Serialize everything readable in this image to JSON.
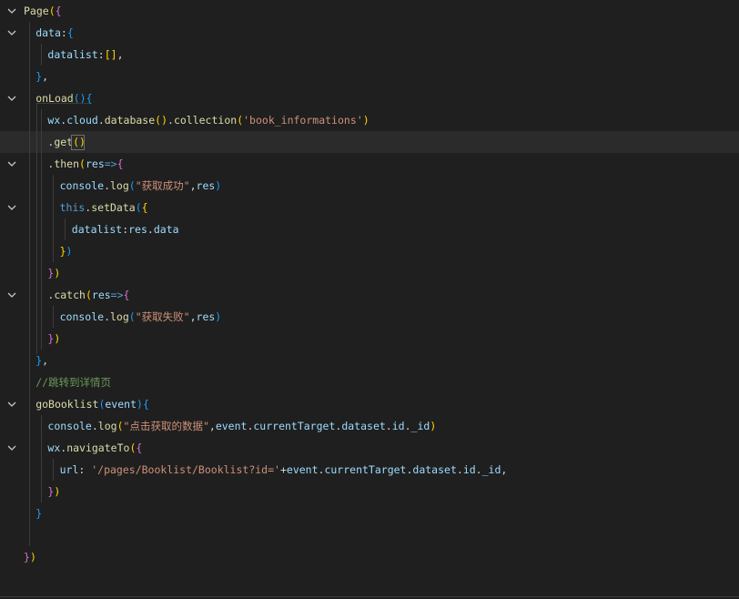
{
  "editor": {
    "lines": [
      {
        "fold": true,
        "tokens": [
          {
            "t": "Page",
            "c": "t-fn"
          },
          {
            "t": "(",
            "c": "t-b1"
          },
          {
            "t": "{",
            "c": "t-b2"
          }
        ]
      },
      {
        "fold": true,
        "tokens": [
          {
            "t": "data",
            "c": "t-ident"
          },
          {
            "t": ":",
            "c": "t-plain"
          },
          {
            "t": "{",
            "c": "t-b3"
          }
        ]
      },
      {
        "fold": false,
        "tokens": [
          {
            "t": "datalist",
            "c": "t-ident"
          },
          {
            "t": ":",
            "c": "t-plain"
          },
          {
            "t": "[]",
            "c": "t-b1"
          },
          {
            "t": ",",
            "c": "t-plain"
          }
        ]
      },
      {
        "fold": false,
        "tokens": [
          {
            "t": "}",
            "c": "t-b3"
          },
          {
            "t": ",",
            "c": "t-plain"
          }
        ]
      },
      {
        "fold": true,
        "tokens": [
          {
            "t": "onLoad",
            "c": "t-fn"
          },
          {
            "t": "()",
            "c": "t-b3"
          },
          {
            "t": "{",
            "c": "t-b3"
          }
        ]
      },
      {
        "fold": false,
        "tokens": [
          {
            "t": "wx",
            "c": "t-ident"
          },
          {
            "t": ".",
            "c": "t-plain"
          },
          {
            "t": "cloud",
            "c": "t-ident"
          },
          {
            "t": ".",
            "c": "t-plain"
          },
          {
            "t": "database",
            "c": "t-fn"
          },
          {
            "t": "()",
            "c": "t-b1"
          },
          {
            "t": ".",
            "c": "t-plain"
          },
          {
            "t": "collection",
            "c": "t-fn"
          },
          {
            "t": "(",
            "c": "t-b1"
          },
          {
            "t": "'book_informations'",
            "c": "t-str"
          },
          {
            "t": ")",
            "c": "t-b1"
          }
        ]
      },
      {
        "fold": false,
        "tokens": [
          {
            "t": ".",
            "c": "t-plain"
          },
          {
            "t": "get",
            "c": "t-fn"
          },
          {
            "t": "()",
            "c": "t-b1"
          }
        ]
      },
      {
        "fold": true,
        "tokens": [
          {
            "t": ".",
            "c": "t-plain"
          },
          {
            "t": "then",
            "c": "t-fn"
          },
          {
            "t": "(",
            "c": "t-b1"
          },
          {
            "t": "res",
            "c": "t-ident"
          },
          {
            "t": "=>",
            "c": "t-kw"
          },
          {
            "t": "{",
            "c": "t-b2"
          }
        ]
      },
      {
        "fold": false,
        "tokens": [
          {
            "t": "console",
            "c": "t-ident"
          },
          {
            "t": ".",
            "c": "t-plain"
          },
          {
            "t": "log",
            "c": "t-fn"
          },
          {
            "t": "(",
            "c": "t-b3"
          },
          {
            "t": "\"获取成功\"",
            "c": "t-str"
          },
          {
            "t": ",",
            "c": "t-plain"
          },
          {
            "t": "res",
            "c": "t-ident"
          },
          {
            "t": ")",
            "c": "t-b3"
          }
        ]
      },
      {
        "fold": true,
        "tokens": [
          {
            "t": "this",
            "c": "t-kw"
          },
          {
            "t": ".",
            "c": "t-plain"
          },
          {
            "t": "setData",
            "c": "t-fn"
          },
          {
            "t": "(",
            "c": "t-b3"
          },
          {
            "t": "{",
            "c": "t-b1"
          }
        ]
      },
      {
        "fold": false,
        "tokens": [
          {
            "t": "datalist",
            "c": "t-ident"
          },
          {
            "t": ":",
            "c": "t-plain"
          },
          {
            "t": "res",
            "c": "t-ident"
          },
          {
            "t": ".",
            "c": "t-plain"
          },
          {
            "t": "data",
            "c": "t-ident"
          }
        ]
      },
      {
        "fold": false,
        "tokens": [
          {
            "t": "}",
            "c": "t-b1"
          },
          {
            "t": ")",
            "c": "t-b3"
          }
        ]
      },
      {
        "fold": false,
        "tokens": [
          {
            "t": "}",
            "c": "t-b2"
          },
          {
            "t": ")",
            "c": "t-b1"
          }
        ]
      },
      {
        "fold": true,
        "tokens": [
          {
            "t": ".",
            "c": "t-plain"
          },
          {
            "t": "catch",
            "c": "t-fn"
          },
          {
            "t": "(",
            "c": "t-b1"
          },
          {
            "t": "res",
            "c": "t-ident"
          },
          {
            "t": "=>",
            "c": "t-kw"
          },
          {
            "t": "{",
            "c": "t-b2"
          }
        ]
      },
      {
        "fold": false,
        "tokens": [
          {
            "t": "console",
            "c": "t-ident"
          },
          {
            "t": ".",
            "c": "t-plain"
          },
          {
            "t": "log",
            "c": "t-fn"
          },
          {
            "t": "(",
            "c": "t-b3"
          },
          {
            "t": "\"获取失败\"",
            "c": "t-str"
          },
          {
            "t": ",",
            "c": "t-plain"
          },
          {
            "t": "res",
            "c": "t-ident"
          },
          {
            "t": ")",
            "c": "t-b3"
          }
        ]
      },
      {
        "fold": false,
        "tokens": [
          {
            "t": "}",
            "c": "t-b2"
          },
          {
            "t": ")",
            "c": "t-b1"
          }
        ]
      },
      {
        "fold": false,
        "tokens": [
          {
            "t": "}",
            "c": "t-b3"
          },
          {
            "t": ",",
            "c": "t-plain"
          }
        ]
      },
      {
        "fold": false,
        "tokens": [
          {
            "t": "//跳转到详情页",
            "c": "t-cmt"
          }
        ]
      },
      {
        "fold": true,
        "tokens": [
          {
            "t": "goBooklist",
            "c": "t-fn"
          },
          {
            "t": "(",
            "c": "t-b3"
          },
          {
            "t": "event",
            "c": "t-ident"
          },
          {
            "t": ")",
            "c": "t-b3"
          },
          {
            "t": "{",
            "c": "t-b3"
          }
        ]
      },
      {
        "fold": false,
        "tokens": [
          {
            "t": "console",
            "c": "t-ident"
          },
          {
            "t": ".",
            "c": "t-plain"
          },
          {
            "t": "log",
            "c": "t-fn"
          },
          {
            "t": "(",
            "c": "t-b1"
          },
          {
            "t": "\"点击获取的数据\"",
            "c": "t-str"
          },
          {
            "t": ",",
            "c": "t-plain"
          },
          {
            "t": "event",
            "c": "t-ident"
          },
          {
            "t": ".",
            "c": "t-plain"
          },
          {
            "t": "currentTarget",
            "c": "t-ident"
          },
          {
            "t": ".",
            "c": "t-plain"
          },
          {
            "t": "dataset",
            "c": "t-ident"
          },
          {
            "t": ".",
            "c": "t-plain"
          },
          {
            "t": "id",
            "c": "t-ident"
          },
          {
            "t": ".",
            "c": "t-plain"
          },
          {
            "t": "_id",
            "c": "t-ident"
          },
          {
            "t": ")",
            "c": "t-b1"
          }
        ]
      },
      {
        "fold": true,
        "tokens": [
          {
            "t": "wx",
            "c": "t-ident"
          },
          {
            "t": ".",
            "c": "t-plain"
          },
          {
            "t": "navigateTo",
            "c": "t-fn"
          },
          {
            "t": "(",
            "c": "t-b1"
          },
          {
            "t": "{",
            "c": "t-b2"
          }
        ]
      },
      {
        "fold": false,
        "tokens": [
          {
            "t": "url",
            "c": "t-ident"
          },
          {
            "t": ": ",
            "c": "t-plain"
          },
          {
            "t": "'/pages/Booklist/Booklist?id='",
            "c": "t-str"
          },
          {
            "t": "+",
            "c": "t-plain"
          },
          {
            "t": "event",
            "c": "t-ident"
          },
          {
            "t": ".",
            "c": "t-plain"
          },
          {
            "t": "currentTarget",
            "c": "t-ident"
          },
          {
            "t": ".",
            "c": "t-plain"
          },
          {
            "t": "dataset",
            "c": "t-ident"
          },
          {
            "t": ".",
            "c": "t-plain"
          },
          {
            "t": "id",
            "c": "t-ident"
          },
          {
            "t": ".",
            "c": "t-plain"
          },
          {
            "t": "_id",
            "c": "t-ident"
          },
          {
            "t": ",",
            "c": "t-plain"
          }
        ]
      },
      {
        "fold": false,
        "tokens": [
          {
            "t": "}",
            "c": "t-b2"
          },
          {
            "t": ")",
            "c": "t-b1"
          }
        ]
      },
      {
        "fold": false,
        "tokens": [
          {
            "t": "}",
            "c": "t-b3"
          }
        ]
      },
      {
        "fold": false,
        "tokens": []
      },
      {
        "fold": false,
        "tokens": [
          {
            "t": "}",
            "c": "t-b2"
          },
          {
            "t": ")",
            "c": "t-b1"
          }
        ]
      }
    ]
  }
}
